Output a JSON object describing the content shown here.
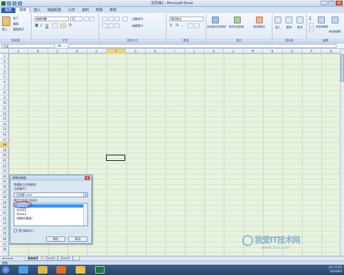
{
  "window": {
    "title": "活頁簿1 - Microsoft Excel",
    "controls": [
      "_",
      "□",
      "×"
    ]
  },
  "ribbon_tabs": [
    "檔案",
    "常用",
    "插入",
    "版面配置",
    "公式",
    "資料",
    "校閱",
    "檢視"
  ],
  "ribbon_active_tab": "常用",
  "ribbon": {
    "clipboard": {
      "label": "剪貼簿",
      "paste": "貼上",
      "cut": "剪下",
      "copy": "複製",
      "format_painter": "複製格式"
    },
    "font": {
      "label": "字型",
      "font_name": "新細明體",
      "font_size": "12"
    },
    "alignment": {
      "label": "對齊方式",
      "wrap": "自動換列",
      "merge": "跨欄置中"
    },
    "number": {
      "label": "數值",
      "format": "通用格式"
    },
    "styles": {
      "label": "樣式",
      "conditional": "設定格式化的條件",
      "table": "格式化為表格",
      "cell_styles": "儲存格樣式"
    },
    "cells": {
      "label": "儲存格",
      "insert": "插入",
      "delete": "刪除",
      "format": "格式"
    },
    "editing": {
      "label": "編輯",
      "sort": "排序與篩選",
      "find": "尋找與選取"
    }
  },
  "formula_bar": {
    "name_box": "F18",
    "fx": "fx",
    "value": ""
  },
  "columns": [
    "A",
    "B",
    "C",
    "D",
    "E",
    "F",
    "G",
    "H",
    "I",
    "J",
    "K",
    "L",
    "M",
    "N",
    "O",
    "P",
    "Q"
  ],
  "selected_column": "F",
  "rows": [
    "1",
    "2",
    "3",
    "4",
    "5",
    "6",
    "7",
    "8",
    "9",
    "10",
    "11",
    "12",
    "13",
    "14",
    "15",
    "16",
    "17",
    "18",
    "19",
    "20",
    "21",
    "22",
    "23",
    "24",
    "25",
    "26",
    "27",
    "28",
    "29",
    "30",
    "31",
    "32",
    "33",
    "34",
    "35",
    "36",
    "37",
    "38"
  ],
  "selected_row": "18",
  "sheet_tabs": [
    "業務報表",
    "Sheet2",
    "Sheet3"
  ],
  "status": "就緒",
  "dialog": {
    "title": "移動或複製",
    "x": "×",
    "subtitle": "將選取工作表移到",
    "to_book_label": "活頁簿(T):",
    "to_book_value": "活頁簿1.xlsx",
    "before_label": "選定工作表之前(B):",
    "sheets": [
      "業務報表",
      "Sheet2",
      "Sheet3",
      "(移動到最後)"
    ],
    "selected_index": 0,
    "copy_label": "建立複本(C)",
    "ok": "確定",
    "cancel": "取消"
  },
  "taskbar": {
    "time": "上午 11:31",
    "date": "2014/9/3"
  },
  "watermark": {
    "text": "我爱IT技术网",
    "url": "www.52ij.com"
  }
}
